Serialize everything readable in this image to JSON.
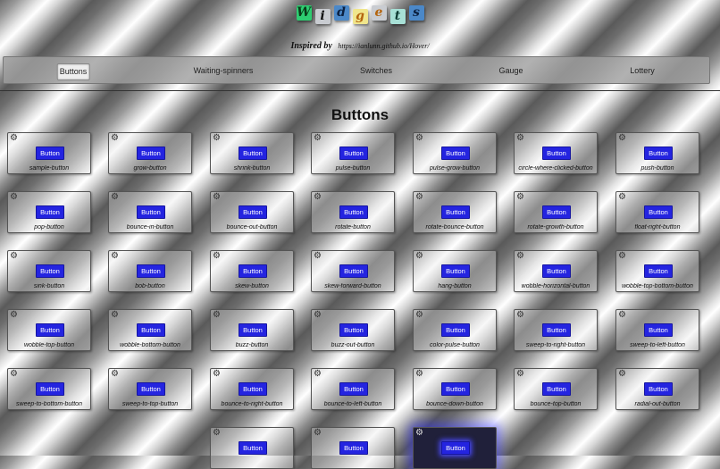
{
  "header": {
    "logo_letters": [
      {
        "char": "W",
        "bg": "#2ecc71",
        "fg": "#0a3a1a"
      },
      {
        "char": "i",
        "bg": "#c9ccd1",
        "fg": "#111111"
      },
      {
        "char": "d",
        "bg": "#4b88c8",
        "fg": "#0b2040"
      },
      {
        "char": "g",
        "bg": "#f0e68c",
        "fg": "#b4650f"
      },
      {
        "char": "e",
        "bg": "#c9ccd1",
        "fg": "#b4650f"
      },
      {
        "char": "t",
        "bg": "#a7e0d6",
        "fg": "#0e3b33"
      },
      {
        "char": "s",
        "bg": "#4b88c8",
        "fg": "#0b2040"
      }
    ],
    "inspired_label": "Inspired by",
    "inspired_link": "https://ianlunn.github.io/Hover/"
  },
  "nav": {
    "items": [
      "Buttons",
      "Waiting-spinners",
      "Switches",
      "Gauge",
      "Lottery"
    ],
    "active": "Buttons"
  },
  "page_title": "Buttons",
  "button_label": "Button",
  "gear_icon": "⚙",
  "effects": [
    "sample-button",
    "grow-button",
    "shrink-button",
    "pulse-button",
    "pulse-grow-button",
    "circle-where-clicked-button",
    "push-button",
    "pop-button",
    "bounce-in-button",
    "bounce-out-button",
    "rotate-button",
    "rotate-bounce-button",
    "rotate-growth-button",
    "float-right-button",
    "sink-button",
    "bob-button",
    "skew-button",
    "skew-forward-button",
    "hang-button",
    "wobble-horizontal-button",
    "wobble-top-bottom-button",
    "wobble-top-button",
    "wobble-bottom-button",
    "buzz-button",
    "buzz-out-button",
    "color-pulse-button",
    "sweep-to-right-button",
    "sweep-to-left-button",
    "sweep-to-bottom-button",
    "sweep-to-top-button",
    "bounce-to-right-button",
    "bounce-to-left-button",
    "bounce-down-button",
    "bounce-top-button",
    "radial-out-button",
    "",
    "",
    "",
    "",
    ""
  ],
  "partial_row": [
    {
      "label": ""
    },
    {
      "label": ""
    },
    {
      "label": ""
    }
  ],
  "highlighted_card_index": 2
}
